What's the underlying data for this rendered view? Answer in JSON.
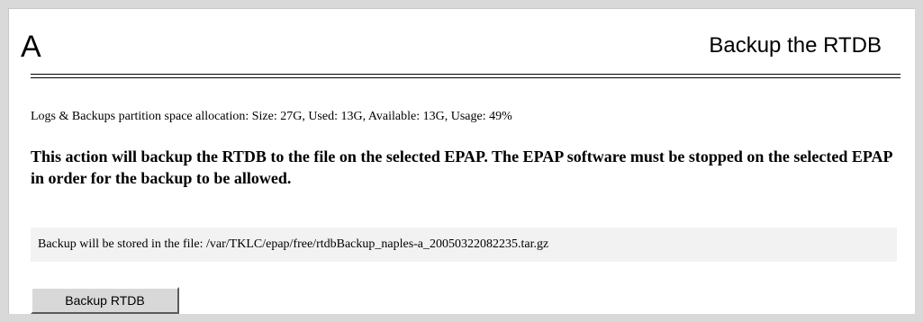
{
  "header": {
    "letter": "A",
    "title": "Backup the RTDB"
  },
  "space_allocation": "Logs & Backups partition space allocation: Size: 27G, Used: 13G, Available: 13G, Usage: 49%",
  "warning": "This action will backup the RTDB to the file on the selected EPAP. The EPAP software must be stopped on the selected EPAP in order for the backup to be allowed.",
  "backup_file_text": "Backup will be stored in the file: /var/TKLC/epap/free/rtdbBackup_naples-a_20050322082235.tar.gz",
  "actions": {
    "backup_button_label": "Backup RTDB"
  }
}
